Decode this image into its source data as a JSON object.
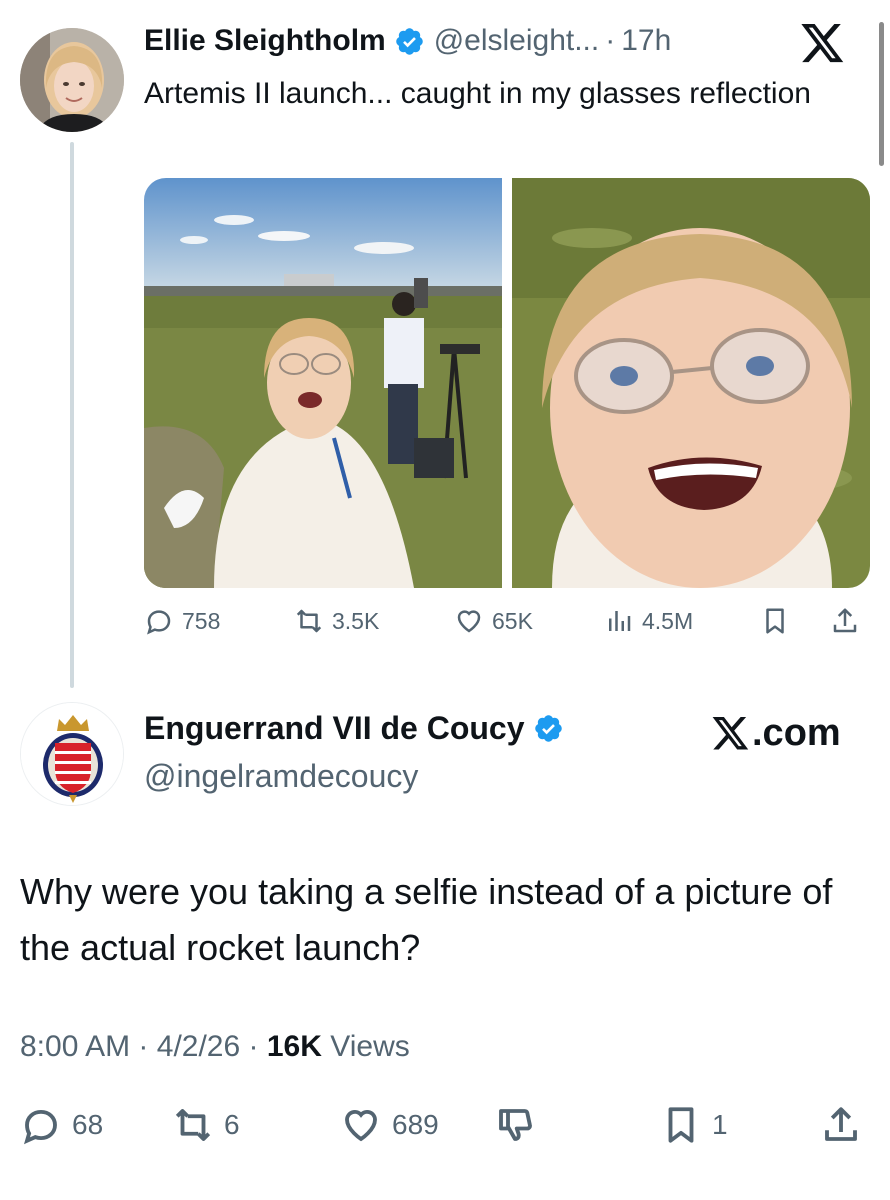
{
  "quoted_tweet": {
    "author_name": "Ellie Sleightholm",
    "handle": "@elsleight...",
    "separator": "·",
    "time": "17h",
    "text": "Artemis II launch... caught in my glasses reflection",
    "images": [
      "launch-crowd-selfie",
      "glasses-reflection-closeup"
    ],
    "stats": {
      "replies": "758",
      "reposts": "3.5K",
      "likes": "65K",
      "views": "4.5M"
    }
  },
  "reply_tweet": {
    "author_name": "Enguerrand VII de Coucy",
    "handle": "@ingelramdecoucy",
    "site_label": ".com",
    "text": "Why were you taking a selfie instead of a picture of the actual rocket launch?",
    "time": "8:00 AM",
    "sep": "·",
    "date": "4/2/26",
    "views_count": "16K",
    "views_label": "Views",
    "stats": {
      "replies": "68",
      "reposts": "6",
      "likes": "689",
      "bookmarks": "1"
    }
  },
  "colors": {
    "verified": "#1d9bf0",
    "muted": "#536471",
    "text": "#0f1419",
    "thread_line": "#cfd9de"
  }
}
